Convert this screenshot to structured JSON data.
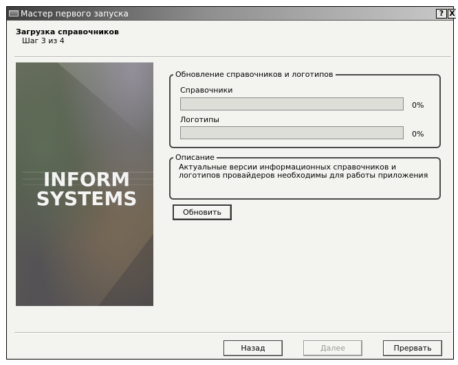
{
  "window": {
    "title": "Мастер первого запуска",
    "help_button": "?",
    "close_button": "X"
  },
  "header": {
    "title": "Загрузка справочников",
    "step": "Шаг 3 из 4"
  },
  "banner": {
    "logo_text": "INFORM SYSTEMS"
  },
  "update_group": {
    "legend": "Обновление справочников и логотипов",
    "directories": {
      "label": "Справочники",
      "progress": 0,
      "percent_text": "0%"
    },
    "logos": {
      "label": "Логотипы",
      "progress": 0,
      "percent_text": "0%"
    }
  },
  "description_group": {
    "legend": "Описание",
    "text": "Актуальные версии информационных справочников и логотипов провайдеров необходимы для работы приложения"
  },
  "buttons": {
    "refresh": "Обновить",
    "back": "Назад",
    "next": "Далее",
    "cancel": "Прервать"
  },
  "colors": {
    "window_bg": "#f3f3ef",
    "border": "#4a4a4a",
    "progress_bg": "#deded8"
  }
}
